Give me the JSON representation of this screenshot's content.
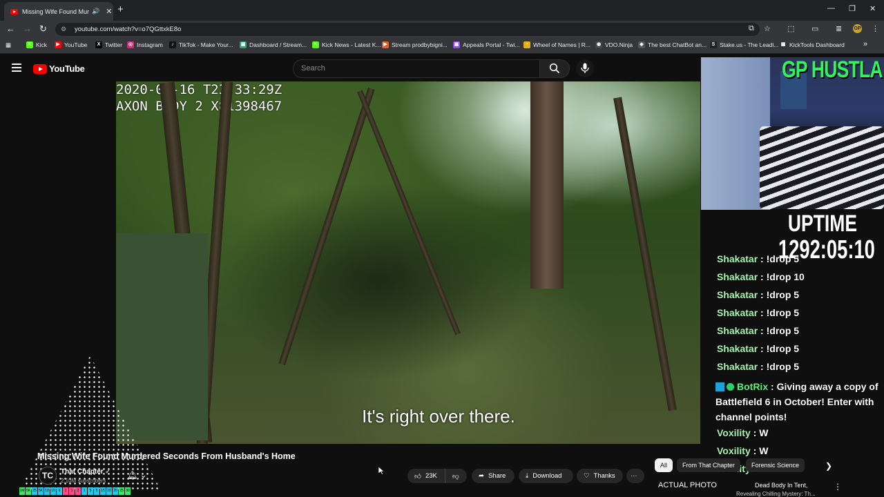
{
  "browser": {
    "tab_title": "Missing Wife Found Murde",
    "speaker": "🔊",
    "tab_close": "✕",
    "new_tab": "+",
    "url": "youtube.com/watch?v=o7QGttxkE8o",
    "window": {
      "minimize": "—",
      "restore": "❐",
      "close": "✕"
    },
    "nav": {
      "back": "←",
      "forward": "→",
      "reload": "↻"
    },
    "profile_initials": "GP",
    "more": "⋮",
    "bookmarks": [
      {
        "label": "Kick",
        "icon": "K",
        "color": "#53fc18"
      },
      {
        "label": "YouTube",
        "icon": "▶",
        "color": "#ff0000"
      },
      {
        "label": "Twitter",
        "icon": "X",
        "color": "#000000"
      },
      {
        "label": "Instagram",
        "icon": "◎",
        "color": "#d62976"
      },
      {
        "label": "TikTok - Make Your...",
        "icon": "♪",
        "color": "#111111"
      },
      {
        "label": "Dashboard / Stream...",
        "icon": "▣",
        "color": "#2fa36b"
      },
      {
        "label": "Kick News - Latest K...",
        "icon": "K",
        "color": "#53fc18"
      },
      {
        "label": "Stream prodbybigni...",
        "icon": "▶",
        "color": "#e0602a"
      },
      {
        "label": "Appeals Portal - Twi...",
        "icon": "▣",
        "color": "#9146ff"
      },
      {
        "label": "Wheel of Names | R...",
        "icon": "◔",
        "color": "#e0b020"
      },
      {
        "label": "VDO.Ninja",
        "icon": "◉",
        "color": "#444444"
      },
      {
        "label": "The best ChatBot an...",
        "icon": "◆",
        "color": "#555555"
      },
      {
        "label": "Stake.us - The Leadi...",
        "icon": "S",
        "color": "#222222"
      },
      {
        "label": "KickTools Dashboard",
        "icon": "▦",
        "color": "#333333"
      }
    ],
    "bookmarks_more": "»"
  },
  "youtube": {
    "logo_text": "YouTube",
    "search_placeholder": "Search"
  },
  "video": {
    "timestamp_line1": "2020-09-16 T23:33:29Z",
    "timestamp_line2": "AXON BODY 2 X81398467",
    "caption": "It's right over there.",
    "title": "Missing Wife Found Murdered Seconds From Husband's Home"
  },
  "channel": {
    "avatar_text": "TC",
    "name": "That Chapter",
    "subscribers": "2.10M subscribers"
  },
  "actions": {
    "likes": "23K",
    "share": "Share",
    "download": "Download",
    "thanks": "Thanks",
    "more": "···"
  },
  "chips": [
    "All",
    "From That Chapter",
    "Forensic Science"
  ],
  "recommendation": {
    "title_prefix": "ACTUAL PHOTO",
    "title_rest": "Dead Body In Tent,",
    "subtitle": "Revealing Chilling Mystery: Th..."
  },
  "overlay": {
    "brand": "GP HUSTLA",
    "uptime_label": "UPTIME",
    "uptime_value": "1292:05:10"
  },
  "chat": [
    {
      "user": "Shakatar",
      "msg": "!drop 5"
    },
    {
      "user": "Shakatar",
      "msg": "!drop 10"
    },
    {
      "user": "Shakatar",
      "msg": "!drop 5"
    },
    {
      "user": "Shakatar",
      "msg": "!drop 5"
    },
    {
      "user": "Shakatar",
      "msg": "!drop 5"
    },
    {
      "user": "Shakatar",
      "msg": "!drop 5"
    },
    {
      "user": "Shakatar",
      "msg": "!drop 5"
    },
    {
      "user": "Voxility",
      "msg": "W"
    },
    {
      "user": "Voxility",
      "msg": "W"
    },
    {
      "user": "Voxility",
      "msg": ""
    }
  ],
  "botrix": {
    "user": "BotRix",
    "msg": "Giving away a copy of Battlefield 6 in October! Enter with channel points!"
  },
  "level_bar": [
    "1M",
    "5K",
    "25",
    "5K",
    "10",
    "10",
    "5",
    "1",
    "1",
    "2",
    "1",
    "5",
    "5",
    "15",
    "10",
    "20",
    "25",
    "30"
  ]
}
